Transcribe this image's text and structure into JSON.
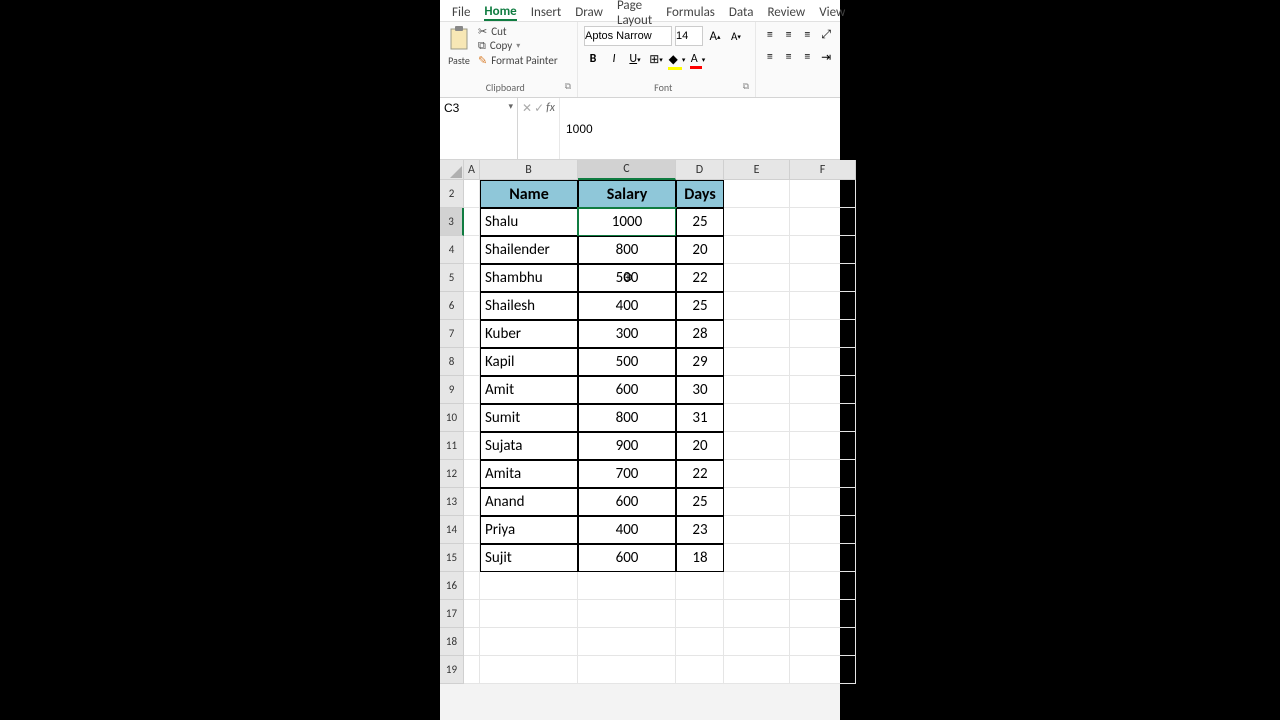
{
  "tabs": [
    "File",
    "Home",
    "Insert",
    "Draw",
    "Page Layout",
    "Formulas",
    "Data",
    "Review",
    "View"
  ],
  "active_tab": "Home",
  "clipboard": {
    "title": "Clipboard",
    "paste": "Paste",
    "cut": "Cut",
    "copy": "Copy",
    "fmt": "Format Painter"
  },
  "font": {
    "title": "Font",
    "name": "Aptos Narrow",
    "size": "14"
  },
  "namebox": "C3",
  "formula": "1000",
  "cols": [
    "A",
    "B",
    "C",
    "D",
    "E",
    "F"
  ],
  "selected_col": "C",
  "selected_row": 3,
  "row_numbers": [
    2,
    3,
    4,
    5,
    6,
    7,
    8,
    9,
    10,
    11,
    12,
    13,
    14,
    15,
    16,
    17,
    18,
    19
  ],
  "headers": {
    "name": "Name",
    "salary": "Salary",
    "days": "Days"
  },
  "rows": [
    {
      "name": "Shalu",
      "salary": "1000",
      "days": "25"
    },
    {
      "name": "Shailender",
      "salary": "800",
      "days": "20"
    },
    {
      "name": "Shambhu",
      "salary": "500",
      "days": "22"
    },
    {
      "name": "Shailesh",
      "salary": "400",
      "days": "25"
    },
    {
      "name": "Kuber",
      "salary": "300",
      "days": "28"
    },
    {
      "name": "Kapil",
      "salary": "500",
      "days": "29"
    },
    {
      "name": "Amit",
      "salary": "600",
      "days": "30"
    },
    {
      "name": "Sumit",
      "salary": "800",
      "days": "31"
    },
    {
      "name": "Sujata",
      "salary": "900",
      "days": "20"
    },
    {
      "name": "Amita",
      "salary": "700",
      "days": "22"
    },
    {
      "name": "Anand",
      "salary": "600",
      "days": "25"
    },
    {
      "name": "Priya",
      "salary": "400",
      "days": "23"
    },
    {
      "name": "Sujit",
      "salary": "600",
      "days": "18"
    }
  ]
}
